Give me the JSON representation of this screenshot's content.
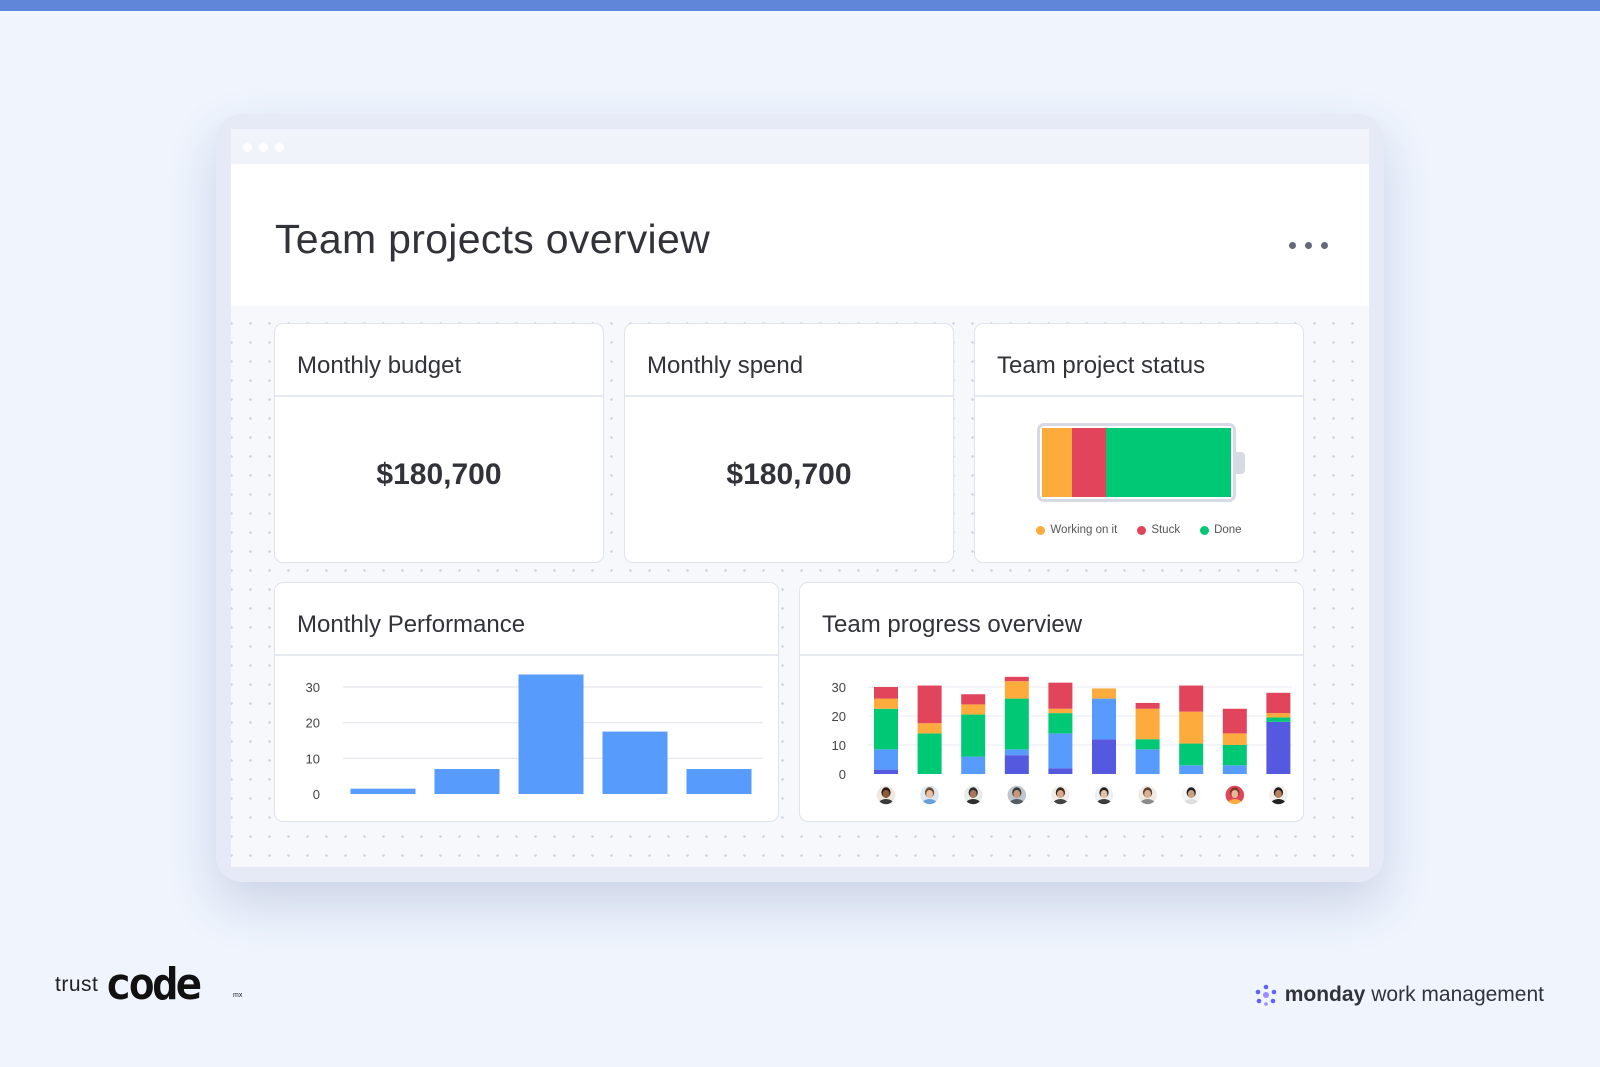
{
  "page": {
    "title": "Team projects overview",
    "menu_icon": "more-horizontal-icon"
  },
  "widgets": {
    "monthly_budget": {
      "title": "Monthly budget",
      "value": "$180,700"
    },
    "monthly_spend": {
      "title": "Monthly spend",
      "value": "$180,700"
    },
    "team_project_status": {
      "title": "Team project status",
      "segments": [
        {
          "label": "Working on it",
          "share": 0.16,
          "color": "#fdab3d"
        },
        {
          "label": "Stuck",
          "share": 0.18,
          "color": "#e2445c"
        },
        {
          "label": "Done",
          "share": 0.66,
          "color": "#00c875"
        }
      ]
    },
    "monthly_performance": {
      "title": "Monthly Performance"
    },
    "team_progress_overview": {
      "title": "Team progress overview"
    }
  },
  "chart_data": [
    {
      "type": "bar",
      "title": "Monthly Performance",
      "categories": [
        "",
        "",
        "",
        "",
        ""
      ],
      "values": [
        1.5,
        7,
        33.5,
        17.5,
        7
      ],
      "yticks": [
        "0",
        "10",
        "20",
        "30"
      ],
      "ylim": [
        0,
        30
      ],
      "grid": true,
      "color": "#579bfc"
    },
    {
      "type": "bar",
      "stacked": true,
      "title": "Team progress overview",
      "categories": [
        "",
        "",
        "",
        "",
        "",
        "",
        "",
        "",
        "",
        ""
      ],
      "yticks": [
        "0",
        "10",
        "20",
        "30"
      ],
      "ylim": [
        0,
        30
      ],
      "grid": true,
      "stack_order": [
        "indigo",
        "blue",
        "green",
        "orange",
        "red"
      ],
      "series": [
        {
          "color": "#5559df",
          "values": [
            1.5,
            0,
            0,
            6.5,
            2,
            12,
            0,
            0,
            0,
            18
          ]
        },
        {
          "color": "#579bfc",
          "values": [
            7,
            0,
            6,
            2,
            12,
            14,
            8.5,
            3,
            3,
            0
          ]
        },
        {
          "color": "#00c875",
          "values": [
            14,
            14,
            14.5,
            17.5,
            7,
            0,
            3.5,
            7.5,
            7,
            1.5
          ]
        },
        {
          "color": "#fdab3d",
          "values": [
            3.5,
            3.5,
            3.5,
            6,
            1.5,
            3.5,
            10.5,
            11,
            4,
            1.5
          ]
        },
        {
          "color": "#e2445c",
          "values": [
            4,
            13,
            3.5,
            1.5,
            9,
            0,
            2,
            9,
            8.5,
            7
          ]
        }
      ]
    }
  ],
  "avatars": [
    {
      "skin": "#8d5a3b",
      "hair": "#2a1a12",
      "bg": "#f0e8e0",
      "shirt": "#3b3b3b"
    },
    {
      "skin": "#e8c0a0",
      "hair": "#6b4a2e",
      "bg": "#dde7f2",
      "shirt": "#6aa0d8"
    },
    {
      "skin": "#a8765a",
      "hair": "#2c2c2c",
      "bg": "#e8ece6",
      "shirt": "#2f2f2f"
    },
    {
      "skin": "#c89878",
      "hair": "#3a3a3a",
      "bg": "#bfc6ce",
      "shirt": "#555c66"
    },
    {
      "skin": "#d8a888",
      "hair": "#3a2418",
      "bg": "#f1eeea",
      "shirt": "#444444"
    },
    {
      "skin": "#e6c2a2",
      "hair": "#1f1f1f",
      "bg": "#eef0f2",
      "shirt": "#3d3d3d"
    },
    {
      "skin": "#d9b090",
      "hair": "#5a4030",
      "bg": "#efeae4",
      "shirt": "#8a8a8a"
    },
    {
      "skin": "#caa080",
      "hair": "#1e1e1e",
      "bg": "#f4f4f4",
      "shirt": "#dddddd"
    },
    {
      "skin": "#e8b898",
      "hair": "#7a3a20",
      "bg": "#e2445c",
      "shirt": "#fdab3d"
    },
    {
      "skin": "#b98060",
      "hair": "#1a1a1a",
      "bg": "#f3f0ec",
      "shirt": "#222222"
    }
  ],
  "branding": {
    "left_trust": "trust",
    "left_code": "code",
    "left_mx": "mx",
    "right_logo_icon": "monday-logo-icon",
    "right_bold": "monday",
    "right_rest": "work management"
  }
}
